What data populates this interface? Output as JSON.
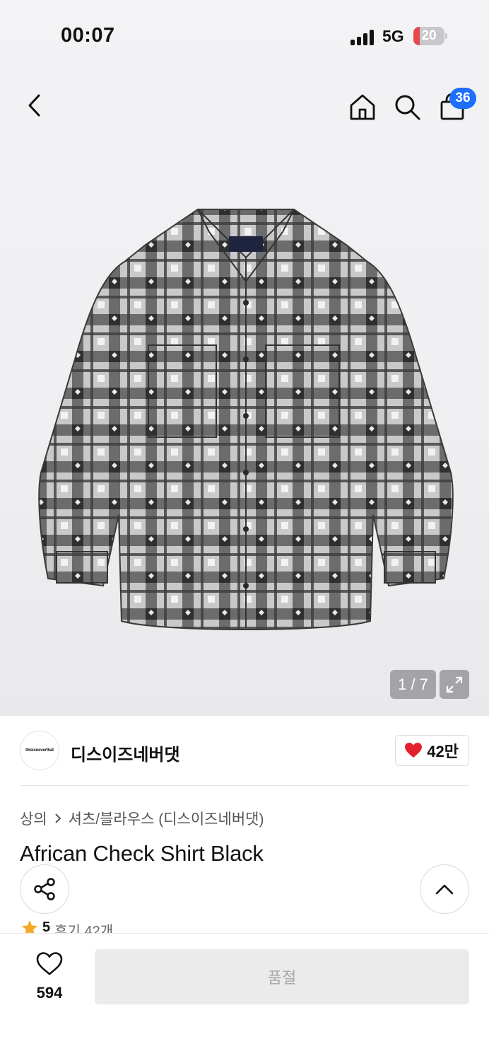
{
  "status_bar": {
    "time": "00:07",
    "network": "5G",
    "battery_level": "20",
    "battery_fraction": 0.2,
    "battery_color": "#e5484d"
  },
  "nav": {
    "back_icon": "chevron-left-icon",
    "home_icon": "home-icon",
    "search_icon": "search-icon",
    "cart_icon": "shopping-bag-icon",
    "cart_count": "36",
    "badge_color": "#1f6fff"
  },
  "gallery": {
    "image_description_icon": "plaid-shirt-image",
    "current": "1 / 7",
    "expand_icon": "expand-icon"
  },
  "brand": {
    "logo_text": "thisisneverthat",
    "name": "디스이즈네버댓",
    "like_count": "42만",
    "like_icon": "heart-filled-icon",
    "heart_color": "#e5202e"
  },
  "product": {
    "breadcrumb": [
      "상의",
      "셔츠/블라우스 (디스이즈네버댓)"
    ],
    "title": "African Check Shirt Black",
    "share_icon": "share-icon",
    "scroll_top_icon": "chevron-up-icon",
    "rating": "5",
    "reviews": "후기 42개",
    "star_color": "#f5a623"
  },
  "bottom_bar": {
    "wish_icon": "heart-outline-icon",
    "wish_count": "594",
    "buy_label": "품절"
  }
}
